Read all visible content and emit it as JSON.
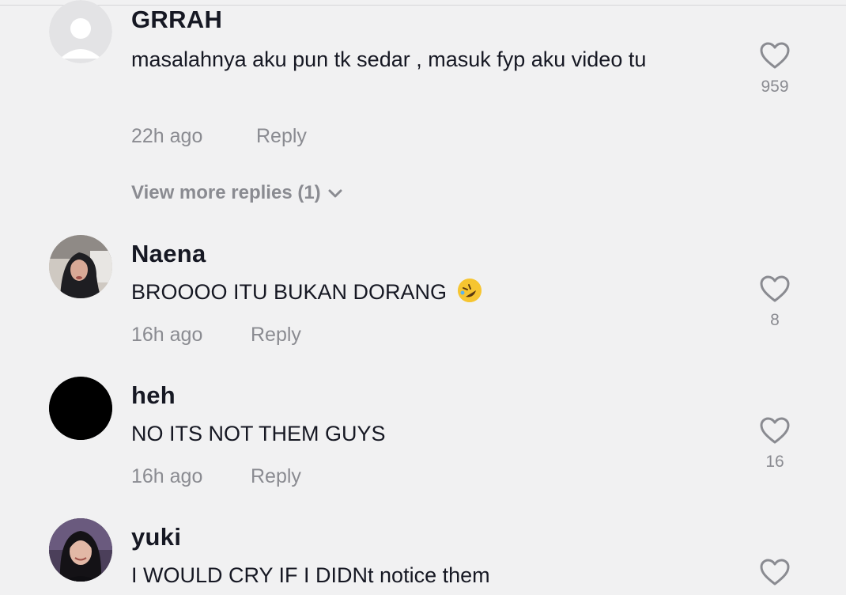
{
  "comments": [
    {
      "username": "GRRAH",
      "text": "masalahnya aku pun tk sedar , masuk fyp aku video tu",
      "time": "22h ago",
      "reply_label": "Reply",
      "likes": "959",
      "avatar": "default-person-icon",
      "view_more": "View more replies (1)"
    },
    {
      "username": "Naena",
      "text": "BROOOO ITU BUKAN DORANG",
      "emoji": "rolling-on-floor-laughing-emoji",
      "time": "16h ago",
      "reply_label": "Reply",
      "likes": "8",
      "avatar": "photo-woman-hijab"
    },
    {
      "username": "heh",
      "text": "NO ITS NOT THEM GUYS",
      "time": "16h ago",
      "reply_label": "Reply",
      "likes": "16",
      "avatar": "black-circle"
    },
    {
      "username": "yuki",
      "text": "I WOULD CRY IF I DIDNt notice them",
      "avatar": "photo-woman-dark-hair"
    }
  ],
  "colors": {
    "background": "#f1f1f2",
    "primary_text": "#161823",
    "secondary_text": "#8a8b91"
  }
}
